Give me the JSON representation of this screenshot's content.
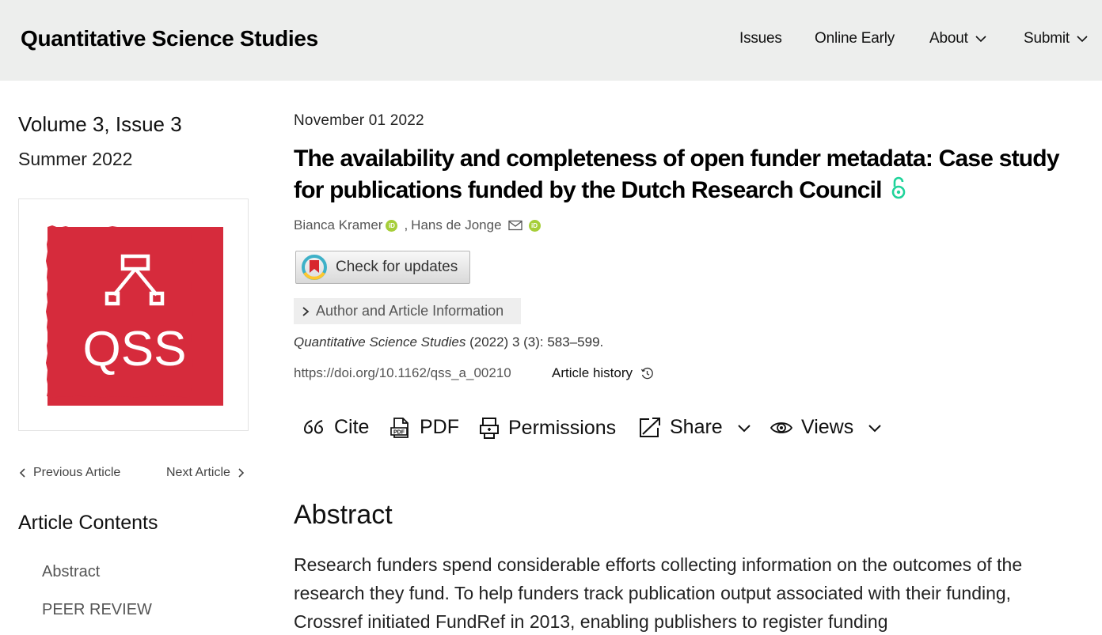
{
  "header": {
    "site_title": "Quantitative Science Studies",
    "nav": [
      {
        "label": "Issues"
      },
      {
        "label": "Online Early"
      },
      {
        "label": "About"
      },
      {
        "label": "Submit"
      }
    ]
  },
  "sidebar": {
    "volume": "Volume 3, Issue 3",
    "season": "Summer 2022",
    "cover_text": "QSS",
    "prev_article": "Previous Article",
    "next_article": "Next Article",
    "contents_title": "Article Contents",
    "toc": [
      "Abstract",
      "PEER REVIEW"
    ]
  },
  "article": {
    "date": "November 01 2022",
    "title": "The availability and completeness of open funder metadata: Case study for publications funded by the Dutch Research Council",
    "authors": [
      {
        "name": "Bianca Kramer"
      },
      {
        "name": "Hans de Jonge"
      }
    ],
    "author_sep": ",",
    "check_updates": "Check for updates",
    "author_info": "Author and Article Information",
    "citation_journal": "Quantitative Science Studies",
    "citation_rest": " (2022) 3 (3): 583–599.",
    "doi": "https://doi.org/10.1162/qss_a_00210",
    "history": "Article history"
  },
  "toolbar": {
    "cite": "Cite",
    "pdf": "PDF",
    "permissions": "Permissions",
    "share": "Share",
    "views": "Views"
  },
  "abstract": {
    "heading": "Abstract",
    "body": "Research funders spend considerable efforts collecting information on the outcomes of the research they fund. To help funders track publication output associated with their funding, Crossref initiated FundRef in 2013, enabling publishers to register funding"
  },
  "colors": {
    "header_bg": "#edeeed",
    "cover_red": "#d62b3c",
    "open_access": "#1fd39a",
    "orcid": "#a6ce39"
  }
}
